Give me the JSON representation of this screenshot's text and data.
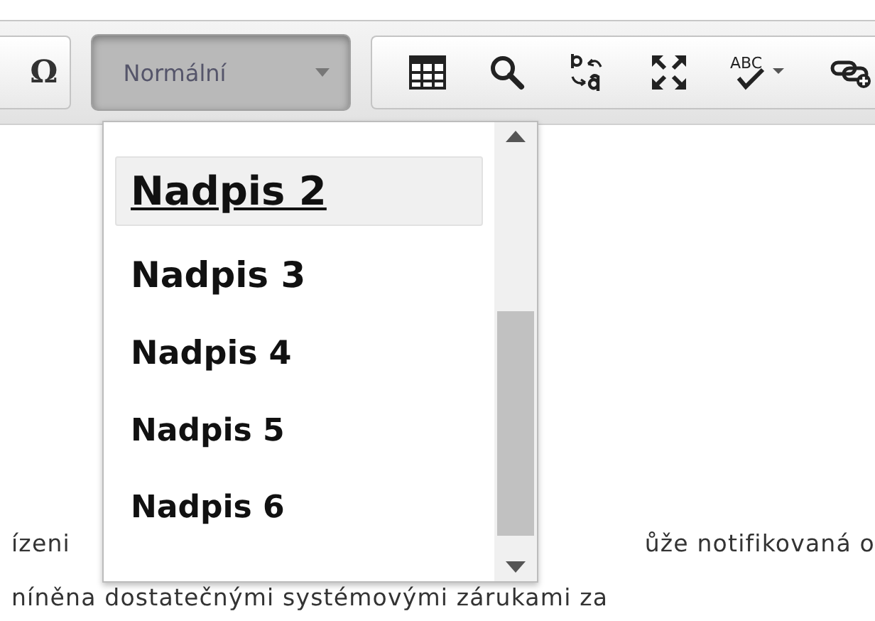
{
  "toolbar": {
    "special_character": "Ω",
    "format_select": {
      "value": "Normální",
      "expanded": true
    },
    "spellcheck_label": "ABC"
  },
  "format_menu": {
    "items": [
      {
        "label": "Nadpis 2",
        "kind": "h2",
        "selected": true
      },
      {
        "label": "Nadpis 3",
        "kind": "h3",
        "selected": false
      },
      {
        "label": "Nadpis 4",
        "kind": "h4",
        "selected": false
      },
      {
        "label": "Nadpis 5",
        "kind": "h5",
        "selected": false
      },
      {
        "label": "Nadpis 6",
        "kind": "h6",
        "selected": false
      }
    ]
  },
  "body": {
    "line_1_left": "ízeni",
    "line_1_right": "ůže  notifikovaná o",
    "line_2": "níněna dostatečnými systémovými zárukami za"
  }
}
